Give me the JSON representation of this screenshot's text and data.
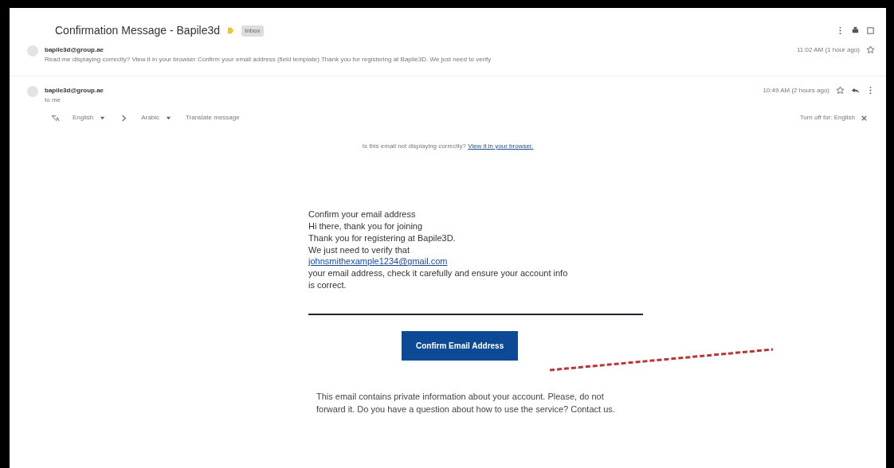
{
  "thread": {
    "subject": "Confirmation Message - Bapile3d",
    "label": "Inbox"
  },
  "collapsed_message": {
    "sender": "bapile3d@group.ae",
    "snippet": "Read me displaying correctly? View it in your browser Confirm your email address (field template) Thank you for registering at Bapile3D. We just need to verify",
    "time": "11:02 AM (1 hour ago)"
  },
  "open_message": {
    "sender": "bapile3d@group.ae",
    "recipient": "to me",
    "time": "10:49 AM (2 hours ago)"
  },
  "translate_bar": {
    "from": "English",
    "to": "Arabic",
    "action": "Translate message",
    "turn_off": "Turn off for: English"
  },
  "view_notice": {
    "text": "Is this email not displaying correctly?",
    "link": "View it in your browser."
  },
  "body": {
    "heading": "Confirm your email address",
    "lines": [
      "Hi there, thank you for joining",
      "Thank you for registering at Bapile3D.",
      "We just need to verify that",
      "your email address, check it carefully and ensure your account info",
      "is correct."
    ],
    "email_link": "johnsmithexample1234@gmail.com",
    "button": "Confirm Email Address",
    "footer": "This email contains private information about your account. Please, do not forward it. Do you have a question about how to use the service? Contact us."
  }
}
